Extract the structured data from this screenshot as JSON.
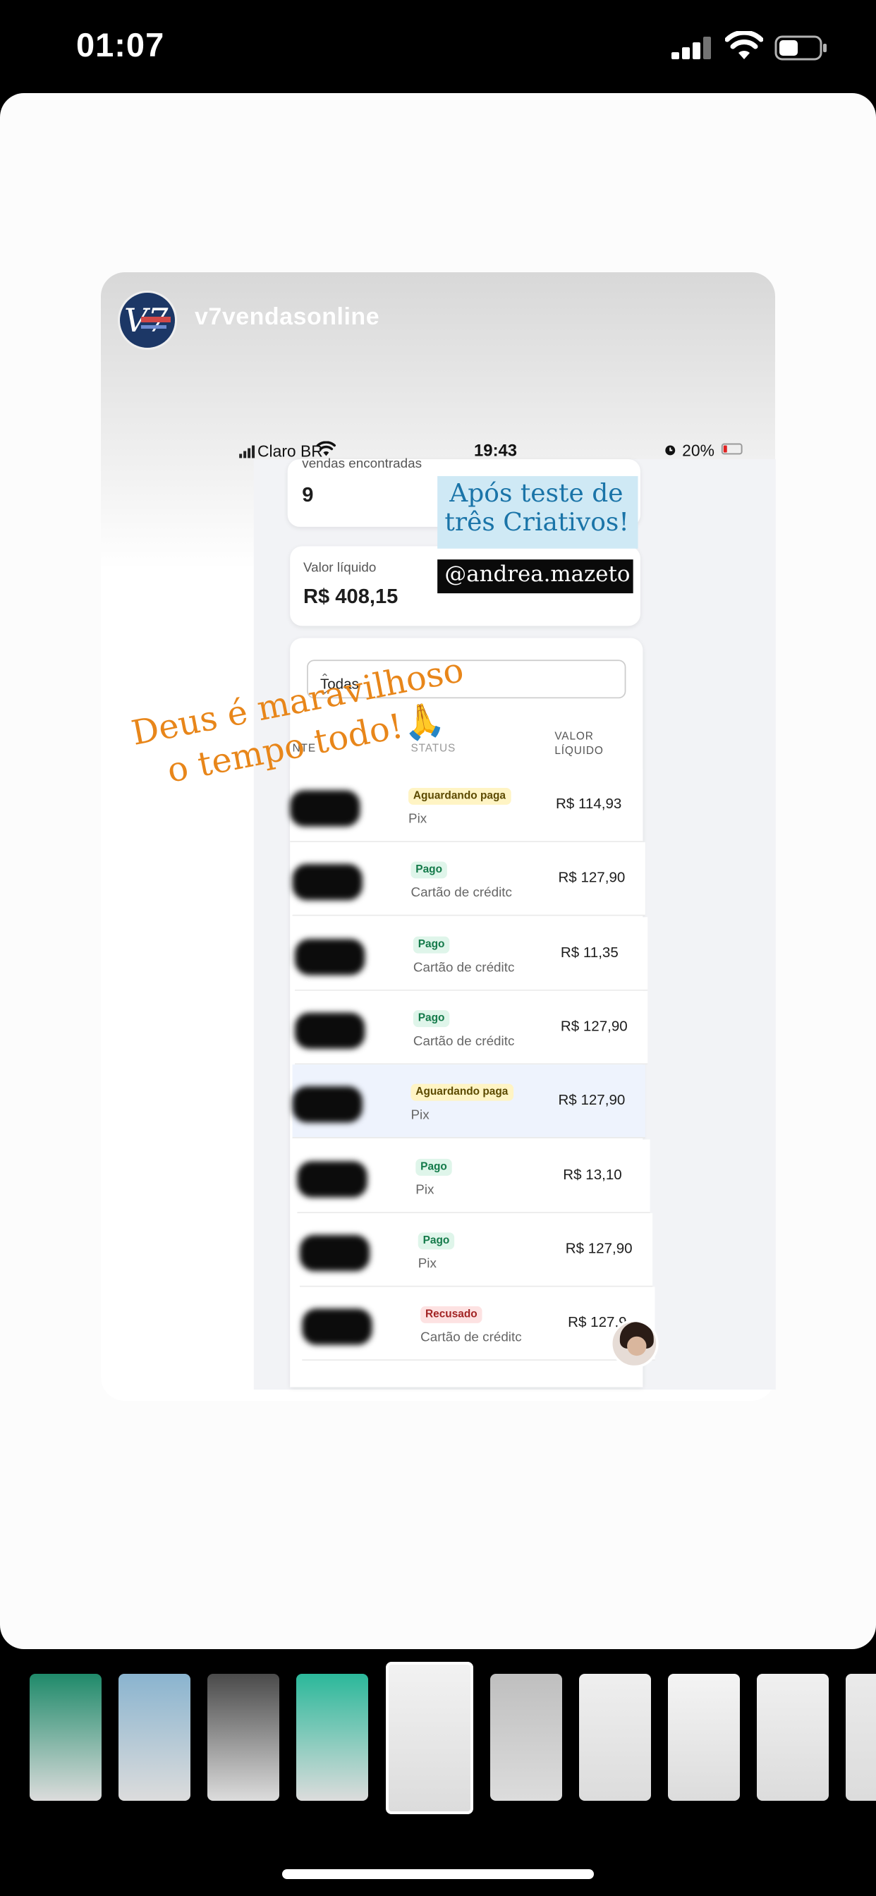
{
  "device_status": {
    "time": "01:07"
  },
  "story": {
    "username": "v7vendasonline",
    "phone_status": {
      "carrier": "Claro BR",
      "time": "19:43",
      "battery": "20%"
    },
    "summary": {
      "vendas_label": "vendas encontradas",
      "vendas_value": "9",
      "liquido_label": "Valor líquido",
      "liquido_value": "R$ 408,15"
    },
    "filter_value": "Todas",
    "table_headers": {
      "cliente": "NTE",
      "status": "STATUS",
      "valor_line1": "VALOR",
      "valor_line2": "LÍQUIDO"
    },
    "rows": [
      {
        "status": "Aguardando paga",
        "kind": "wait",
        "method": "Pix",
        "amount": "R$ 114,93"
      },
      {
        "status": "Pago",
        "kind": "paid",
        "method": "Cartão de créditc",
        "amount": "R$ 127,90"
      },
      {
        "status": "Pago",
        "kind": "paid",
        "method": "Cartão de créditc",
        "amount": "R$ 11,35"
      },
      {
        "status": "Pago",
        "kind": "paid",
        "method": "Cartão de créditc",
        "amount": "R$ 127,90"
      },
      {
        "status": "Aguardando paga",
        "kind": "wait",
        "method": "Pix",
        "amount": "R$ 127,90"
      },
      {
        "status": "Pago",
        "kind": "paid",
        "method": "Pix",
        "amount": "R$ 13,10"
      },
      {
        "status": "Pago",
        "kind": "paid",
        "method": "Pix",
        "amount": "R$ 127,90"
      },
      {
        "status": "Recusado",
        "kind": "ref",
        "method": "Cartão de créditc",
        "amount": "R$ 127,9"
      }
    ],
    "overlay_line1": "Após teste de",
    "overlay_line2": "três Criativos!",
    "mention": "@andrea.mazeto",
    "quote_line1": "Deus é maravilhoso",
    "quote_line2": "o tempo todo!🙏"
  },
  "thumbnails": [
    {
      "color": "#1f8a6a"
    },
    {
      "color": "#8ab4cf"
    },
    {
      "color": "#4a4a4a"
    },
    {
      "color": "#2bb89a"
    },
    {
      "color": "#f2f2f2",
      "selected": true
    },
    {
      "color": "#bfbfbf"
    },
    {
      "color": "#efefef"
    },
    {
      "color": "#f4f4f4"
    },
    {
      "color": "#f0f0f0"
    },
    {
      "color": "#eaeaea"
    }
  ]
}
